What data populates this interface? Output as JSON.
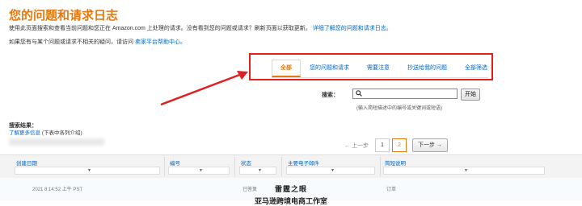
{
  "page": {
    "title": "您的问题和请求日志",
    "description": "使用此页面搜索和查看当前问题和您正在 Amazon.com 上处理的请求。没有看到您的问题或请求？刷新页面以获取更新。",
    "description_link": "详细了解您的问题和请求日志。",
    "help_text": "如果您有与某个问题或请求不相关的疑问，请访问",
    "help_link": "卖家平台帮助中心。"
  },
  "tabs": [
    {
      "label": "全部",
      "active": true
    },
    {
      "label": "您的问题和请求",
      "active": false
    },
    {
      "label": "需要注意",
      "active": false
    },
    {
      "label": "抄送给我的问题",
      "active": false
    },
    {
      "label": "全部筛选",
      "active": false
    }
  ],
  "search": {
    "label": "搜索：",
    "placeholder": "",
    "button": "开始",
    "hint": "(输入简短描述中的编号或关键词或短语)",
    "icon": "search-icon"
  },
  "results": {
    "label": "搜索结果：",
    "link": "了解更多信息",
    "note": "(下表中各列介绍)"
  },
  "pagination": {
    "prev": "← 上一步",
    "pages": [
      "1",
      "2"
    ],
    "current": "2",
    "next": "下一步 →"
  },
  "table": {
    "columns": [
      "创建日期",
      "编号",
      "状态",
      "主要电子邮件",
      "简短说明"
    ],
    "row": {
      "date": "2021 8:14:52 上午 PST",
      "status": "已答复",
      "desc": "订单"
    }
  },
  "caption": {
    "line1": "雷霆之眼",
    "line2": "亚马逊跨境电商工作室"
  },
  "colors": {
    "accent": "#e47911",
    "link": "#0066c0",
    "highlight": "#e02020"
  }
}
